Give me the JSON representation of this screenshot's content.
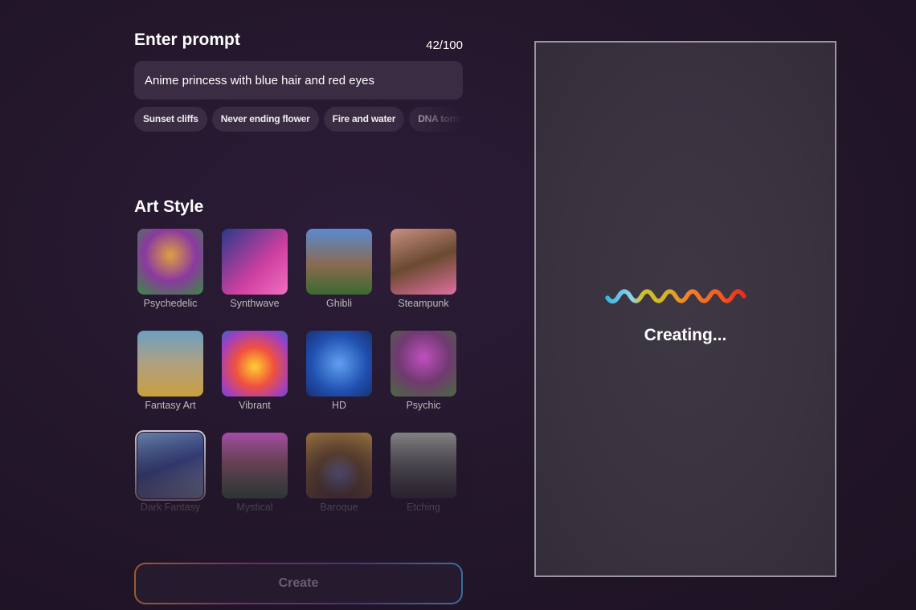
{
  "prompt": {
    "heading": "Enter prompt",
    "counter": "42/100",
    "value": "Anime princess with blue hair and red eyes"
  },
  "suggestions": [
    "Sunset cliffs",
    "Never ending flower",
    "Fire and water",
    "DNA tornado"
  ],
  "art_style": {
    "heading": "Art Style",
    "selected": "Dark Fantasy",
    "styles": [
      "Psychedelic",
      "Synthwave",
      "Ghibli",
      "Steampunk",
      "Fantasy Art",
      "Vibrant",
      "HD",
      "Psychic",
      "Dark Fantasy",
      "Mystical",
      "Baroque",
      "Etching"
    ]
  },
  "create_label": "Create",
  "preview": {
    "status": "Creating...",
    "loader_icon": "rainbow-wave-icon"
  }
}
